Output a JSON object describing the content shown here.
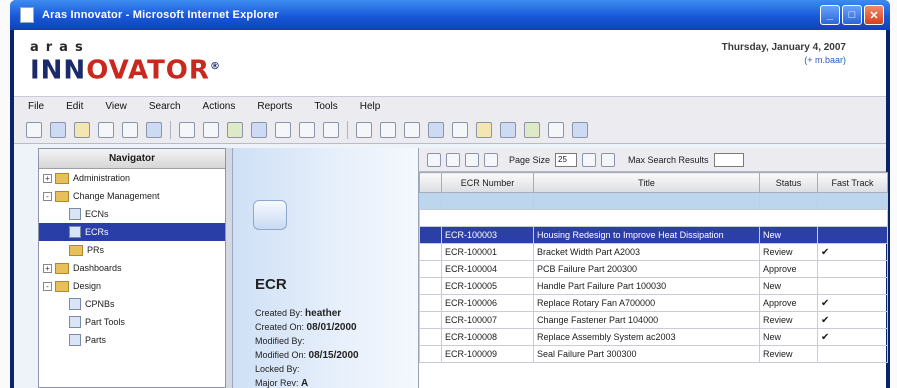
{
  "window": {
    "title": "Aras Innovator - Microsoft Internet Explorer"
  },
  "header": {
    "logo_top": "aras",
    "logo_main_a": "INN",
    "logo_main_b": "OVATOR",
    "date": "Thursday, January 4, 2007",
    "user": "(+ m.baar)"
  },
  "menu": [
    "File",
    "Edit",
    "View",
    "Search",
    "Actions",
    "Reports",
    "Tools",
    "Help"
  ],
  "navigator": {
    "title": "Navigator",
    "items": [
      {
        "label": "Administration",
        "expander": "+"
      },
      {
        "label": "Change Management",
        "expander": "-"
      },
      {
        "label": "ECNs"
      },
      {
        "label": "ECRs"
      },
      {
        "label": "PRs"
      },
      {
        "label": "Dashboards",
        "expander": "+"
      },
      {
        "label": "Design",
        "expander": "-"
      },
      {
        "label": "CPNBs"
      },
      {
        "label": "Part Tools"
      },
      {
        "label": "Parts"
      }
    ]
  },
  "form": {
    "title": "ECR",
    "created_by_label": "Created By:",
    "created_by": "heather",
    "created_on_label": "Created On:",
    "created_on": "08/01/2000",
    "modified_by_label": "Modified By:",
    "modified_on_label": "Modified On:",
    "modified_on": "08/15/2000",
    "locked_by_label": "Locked By:",
    "major_rev_label": "Major Rev:",
    "major_rev": "A"
  },
  "grid": {
    "page_size_label": "Page Size",
    "page_size": "25",
    "max_results_label": "Max Search Results",
    "columns": [
      "ECR Number",
      "Title",
      "Status",
      "Fast Track"
    ],
    "rows": [
      {
        "number": "ECR-100003",
        "title": "Housing Redesign to Improve Heat Dissipation",
        "status": "New",
        "fast": ""
      },
      {
        "number": "ECR-100001",
        "title": "Bracket Width Part A2003",
        "status": "Review",
        "fast": "✔"
      },
      {
        "number": "ECR-100004",
        "title": "PCB Failure Part 200300",
        "status": "Approve",
        "fast": ""
      },
      {
        "number": "ECR-100005",
        "title": "Handle Part Failure Part 100030",
        "status": "New",
        "fast": ""
      },
      {
        "number": "ECR-100006",
        "title": "Replace Rotary Fan A700000",
        "status": "Approve",
        "fast": "✔"
      },
      {
        "number": "ECR-100007",
        "title": "Change Fastener Part 104000",
        "status": "Review",
        "fast": "✔"
      },
      {
        "number": "ECR-100008",
        "title": "Replace Assembly System ac2003",
        "status": "New",
        "fast": "✔"
      },
      {
        "number": "ECR-100009",
        "title": "Seal Failure Part 300300",
        "status": "Review",
        "fast": ""
      }
    ]
  }
}
